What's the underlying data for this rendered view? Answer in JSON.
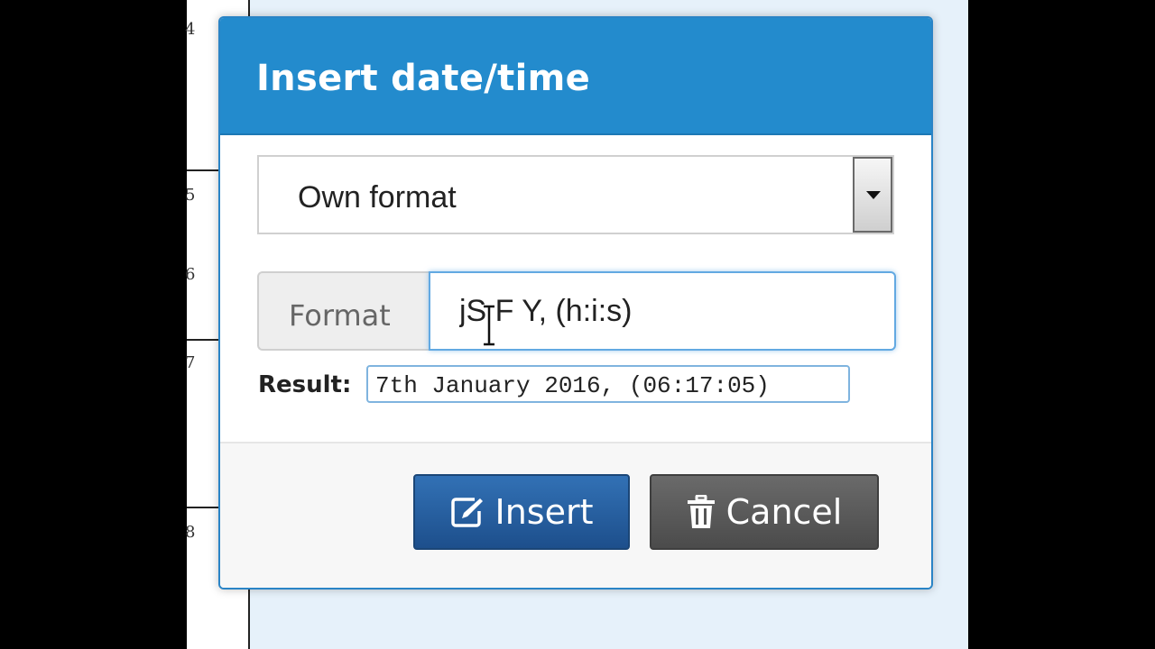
{
  "background": {
    "gutter_numbers": [
      "4",
      "5",
      "6",
      "7",
      "8"
    ]
  },
  "dialog": {
    "title": "Insert date/time",
    "select": {
      "selected": "Own format"
    },
    "format": {
      "label": "Format",
      "value": "jS F Y, (h:i:s)"
    },
    "result": {
      "label": "Result:",
      "value": "7th January 2016, (06:17:05)"
    },
    "buttons": {
      "insert_label": "Insert",
      "cancel_label": "Cancel"
    }
  },
  "colors": {
    "header": "#238bcd",
    "insert_button": "#2a62a3",
    "cancel_button": "#5a5a5a"
  },
  "icons": {
    "insert": "edit-icon",
    "cancel": "trash-icon",
    "dropdown": "caret-down-icon",
    "cursor": "text-cursor-icon"
  }
}
